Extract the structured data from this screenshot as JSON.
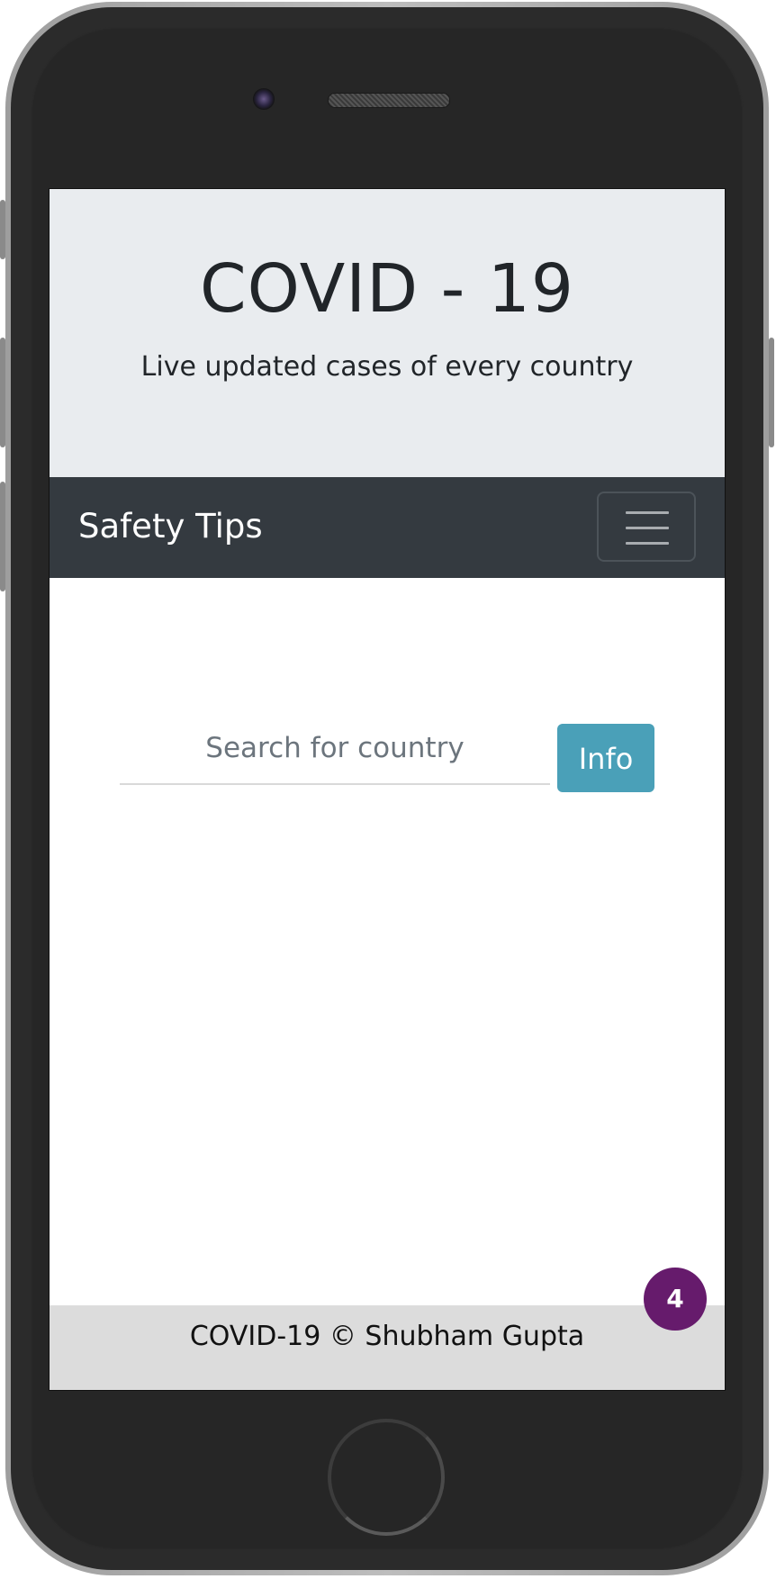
{
  "hero": {
    "title": "COVID - 19",
    "subtitle": "Live updated cases of every country"
  },
  "navbar": {
    "brand": "Safety Tips",
    "toggler_icon": "hamburger-menu-icon"
  },
  "search": {
    "placeholder": "Search for country",
    "value": "",
    "button_label": "Info",
    "button_color": "#4aa0b8"
  },
  "footer": {
    "text": "COVID-19 © Shubham Gupta"
  },
  "badge": {
    "count": "4",
    "color": "#661b6c"
  },
  "colors": {
    "hero_bg": "#e9ecef",
    "navbar_bg": "#343a40",
    "footer_bg": "#dcdcdc"
  }
}
